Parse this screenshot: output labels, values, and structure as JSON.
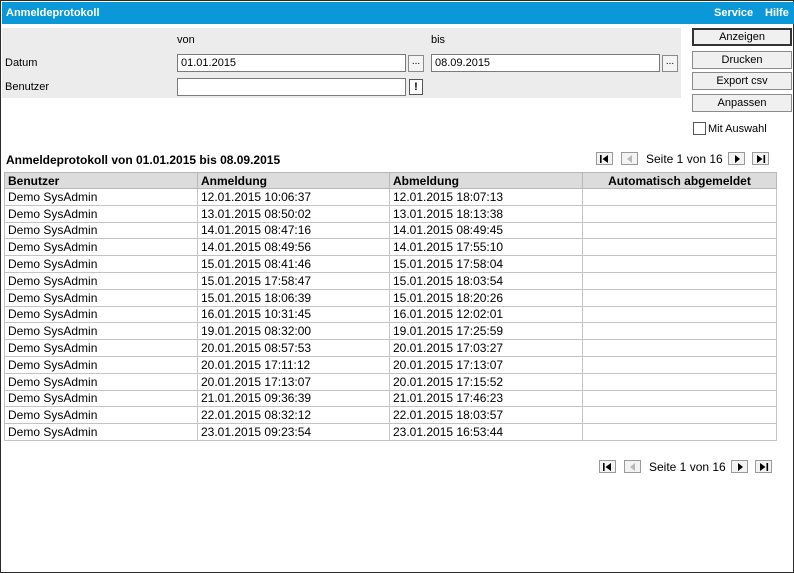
{
  "window": {
    "title": "Anmeldeprotokoll",
    "menu": {
      "service": "Service",
      "hilfe": "Hilfe"
    }
  },
  "filter": {
    "von_label": "von",
    "bis_label": "bis",
    "datum_label": "Datum",
    "benutzer_label": "Benutzer",
    "datum_von": "01.01.2015",
    "datum_bis": "08.09.2015",
    "benutzer_value": "",
    "picker_label": "...",
    "exclaim_label": "!"
  },
  "actions": {
    "anzeigen": "Anzeigen",
    "drucken": "Drucken",
    "export": "Export csv",
    "anpassen": "Anpassen",
    "mit_auswahl": "Mit Auswahl"
  },
  "report": {
    "title": "Anmeldeprotokoll von 01.01.2015 bis 08.09.2015",
    "page_text": "Seite 1 von 16"
  },
  "table": {
    "headers": [
      "Benutzer",
      "Anmeldung",
      "Abmeldung",
      "Automatisch abgemeldet"
    ],
    "rows": [
      [
        "Demo SysAdmin",
        "12.01.2015 10:06:37",
        "12.01.2015 18:07:13",
        ""
      ],
      [
        "Demo SysAdmin",
        "13.01.2015 08:50:02",
        "13.01.2015 18:13:38",
        ""
      ],
      [
        "Demo SysAdmin",
        "14.01.2015 08:47:16",
        "14.01.2015 08:49:45",
        ""
      ],
      [
        "Demo SysAdmin",
        "14.01.2015 08:49:56",
        "14.01.2015 17:55:10",
        ""
      ],
      [
        "Demo SysAdmin",
        "15.01.2015 08:41:46",
        "15.01.2015 17:58:04",
        ""
      ],
      [
        "Demo SysAdmin",
        "15.01.2015 17:58:47",
        "15.01.2015 18:03:54",
        ""
      ],
      [
        "Demo SysAdmin",
        "15.01.2015 18:06:39",
        "15.01.2015 18:20:26",
        ""
      ],
      [
        "Demo SysAdmin",
        "16.01.2015 10:31:45",
        "16.01.2015 12:02:01",
        ""
      ],
      [
        "Demo SysAdmin",
        "19.01.2015 08:32:00",
        "19.01.2015 17:25:59",
        ""
      ],
      [
        "Demo SysAdmin",
        "20.01.2015 08:57:53",
        "20.01.2015 17:03:27",
        ""
      ],
      [
        "Demo SysAdmin",
        "20.01.2015 17:11:12",
        "20.01.2015 17:13:07",
        ""
      ],
      [
        "Demo SysAdmin",
        "20.01.2015 17:13:07",
        "20.01.2015 17:15:52",
        ""
      ],
      [
        "Demo SysAdmin",
        "21.01.2015 09:36:39",
        "21.01.2015 17:46:23",
        ""
      ],
      [
        "Demo SysAdmin",
        "22.01.2015 08:32:12",
        "22.01.2015 18:03:57",
        ""
      ],
      [
        "Demo SysAdmin",
        "23.01.2015 09:23:54",
        "23.01.2015 16:53:44",
        ""
      ]
    ]
  },
  "colors": {
    "titlebar": "#0a98d8",
    "filter_panel": "#ececec",
    "table_header": "#dcdcdc"
  },
  "icons": [
    "first-page-icon",
    "prev-page-icon",
    "next-page-icon",
    "last-page-icon"
  ]
}
